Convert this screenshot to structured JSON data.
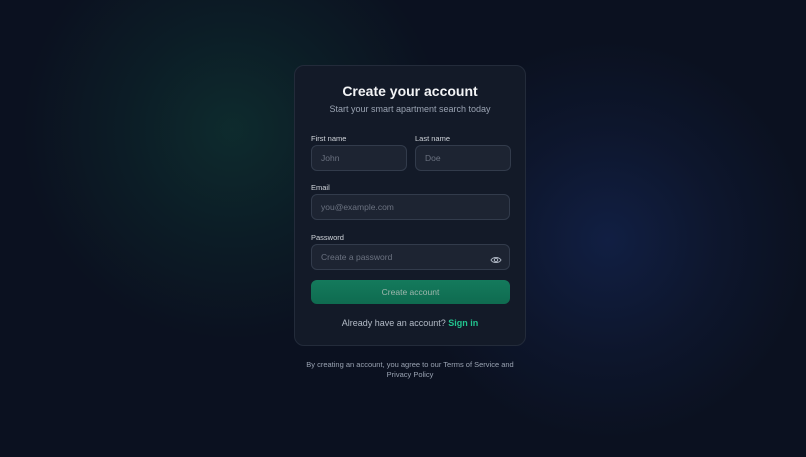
{
  "header": {
    "title": "Create your account",
    "subtitle": "Start your smart apartment search today"
  },
  "form": {
    "first_name": {
      "label": "First name",
      "placeholder": "John",
      "value": ""
    },
    "last_name": {
      "label": "Last name",
      "placeholder": "Doe",
      "value": ""
    },
    "email": {
      "label": "Email",
      "placeholder": "you@example.com",
      "value": ""
    },
    "password": {
      "label": "Password",
      "placeholder": "Create a password",
      "value": "",
      "toggle_icon": "eye-icon"
    },
    "submit_label": "Create account"
  },
  "signin": {
    "prompt": "Already have an account?",
    "link_label": "Sign in"
  },
  "legal": {
    "text": "By creating an account, you agree to our Terms of Service and Privacy Policy"
  },
  "colors": {
    "background": "#0b1120",
    "card": "#131a28",
    "accent": "#22c58f",
    "button": "#147a5c"
  }
}
